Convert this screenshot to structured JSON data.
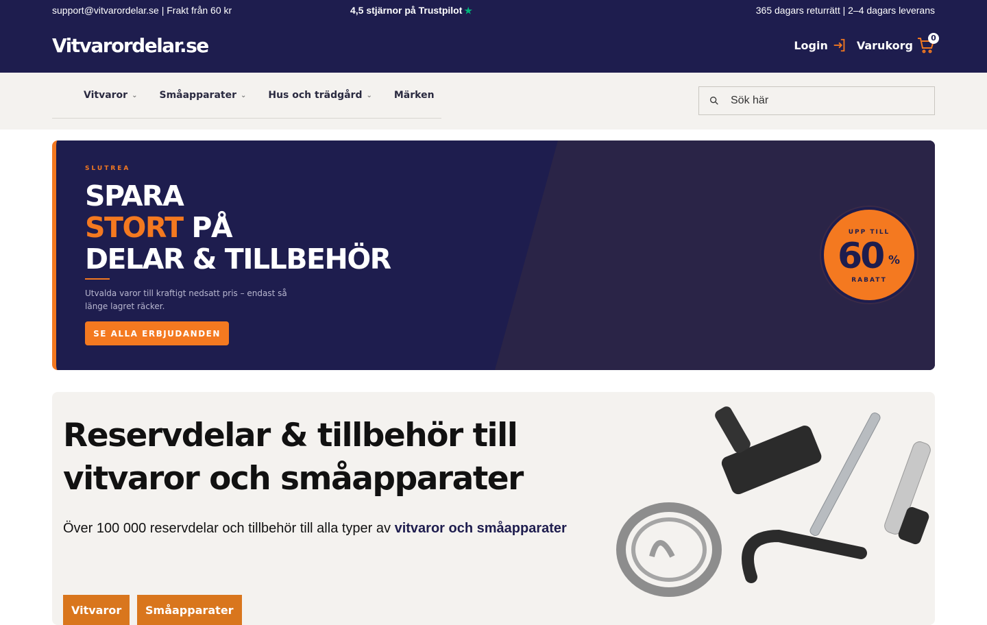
{
  "utility": {
    "left": "support@vitvarordelar.se | Frakt från 60 kr",
    "trust": "4,5 stjärnor på Trustpilot",
    "right": "365 dagars returrätt | 2–4 dagars leverans"
  },
  "logo": "Vitvarordelar.se",
  "account": {
    "login": "Login",
    "cart": "Varukorg",
    "cart_count": "0"
  },
  "nav": {
    "items": [
      {
        "label": "Vitvaror"
      },
      {
        "label": "Småapparater"
      },
      {
        "label": "Hus och trädgård"
      },
      {
        "label": "Märken"
      }
    ]
  },
  "search": {
    "placeholder": "Sök här"
  },
  "promo": {
    "kicker": "SLUTREA",
    "line1": "SPARA",
    "line2_accent": "STORT",
    "line2_rest": "PÅ",
    "line3": "DELAR & TILLBEHÖR",
    "description": "Utvalda varor till kraftigt nedsatt pris – endast så länge lagret räcker.",
    "cta": "SE ALLA ERBJUDANDEN",
    "badge_top": "UPP TILL",
    "badge_value": "60",
    "badge_unit": "%",
    "badge_bottom": "RABATT"
  },
  "hero": {
    "title_line1": "Reservdelar & tillbehör till",
    "title_line2": "vitvaror och småapparater",
    "subtitle_plain": "Över 100 000 reservdelar och tillbehör till alla typer av",
    "subtitle_bold": "vitvaror och småapparater",
    "categories": [
      {
        "label": "Vitvaror"
      },
      {
        "label": "Småapparater"
      }
    ]
  },
  "colors": {
    "navy": "#1e1d4e",
    "orange": "#f47920",
    "beige": "#f4f2ef",
    "trustpilot": "#00b67a"
  }
}
